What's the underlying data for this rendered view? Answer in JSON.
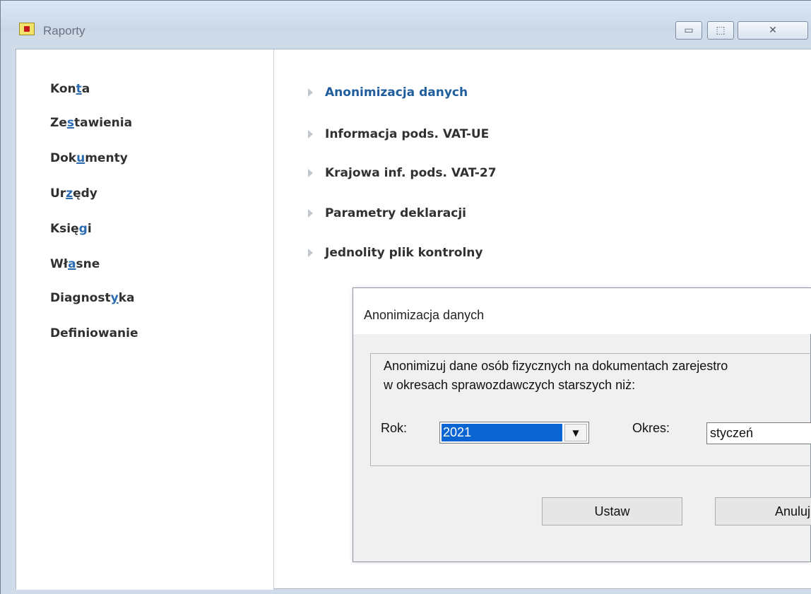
{
  "window": {
    "title": "Raporty",
    "controls": {
      "minimize": "▭",
      "maximize": "⬚",
      "close": "✕"
    }
  },
  "sidebar": {
    "items": [
      {
        "before": "Kon",
        "hot": "t",
        "after": "a"
      },
      {
        "before": "Ze",
        "hot": "s",
        "after": "tawienia"
      },
      {
        "before": "Dok",
        "hot": "u",
        "after": "menty"
      },
      {
        "before": "Ur",
        "hot": "z",
        "after": "ędy"
      },
      {
        "before": "Księ",
        "hot": "g",
        "after": "i"
      },
      {
        "before": "Wł",
        "hot": "a",
        "after": "sne"
      },
      {
        "before": "Diagnost",
        "hot": "y",
        "after": "ka"
      },
      {
        "before": "Def",
        "hot": "i",
        "after": "niowanie"
      }
    ]
  },
  "menu": {
    "items": [
      {
        "label": "Anonimizacja danych",
        "active": true
      },
      {
        "label": "Informacja pods. VAT-UE",
        "active": false
      },
      {
        "label": "Krajowa inf. pods. VAT-27",
        "active": false
      },
      {
        "label": "Parametry deklaracji",
        "active": false
      },
      {
        "label": "Jednolity plik kontrolny",
        "active": false
      }
    ]
  },
  "dialog": {
    "title": "Anonimizacja danych",
    "description_line1": "Anonimizuj dane osób fizycznych na dokumentach zarejestro",
    "description_line2": "w okresach sprawozdawczych starszych niż:",
    "rok_label": "Rok:",
    "rok_value": "2021",
    "okres_label": "Okres:",
    "okres_value": "styczeń",
    "ustaw_label": "Ustaw",
    "anuluj_label": "Anuluj",
    "dropdown_icon": "▼"
  },
  "colors": {
    "accent": "#1f5d9c",
    "hotkey": "#2b6cb0",
    "selection": "#0a64d2"
  }
}
